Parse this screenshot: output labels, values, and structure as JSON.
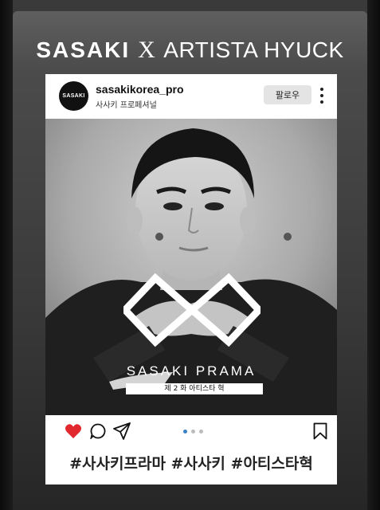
{
  "banner": {
    "brand_left": "SASAKI",
    "brand_x": "X",
    "brand_right": "ARTISTA HYUCK"
  },
  "post": {
    "avatar_text": "SASAKI",
    "username": "sasakikorea_pro",
    "subname": "사사키 프로페셔널",
    "follow_label": "팔로우",
    "image": {
      "title": "SASAKI PRAMA",
      "episode": "제 2 화   아티스타 혁"
    },
    "carousel": {
      "count": 3,
      "active_index": 0
    },
    "hashtags": "#사사키프라마 #사사키 #아티스타혁"
  },
  "colors": {
    "heart": "#e0282e",
    "active_dot": "#3b82c4"
  },
  "icons": [
    "heart-icon",
    "comment-icon",
    "share-icon",
    "bookmark-icon",
    "more-vertical-icon"
  ]
}
